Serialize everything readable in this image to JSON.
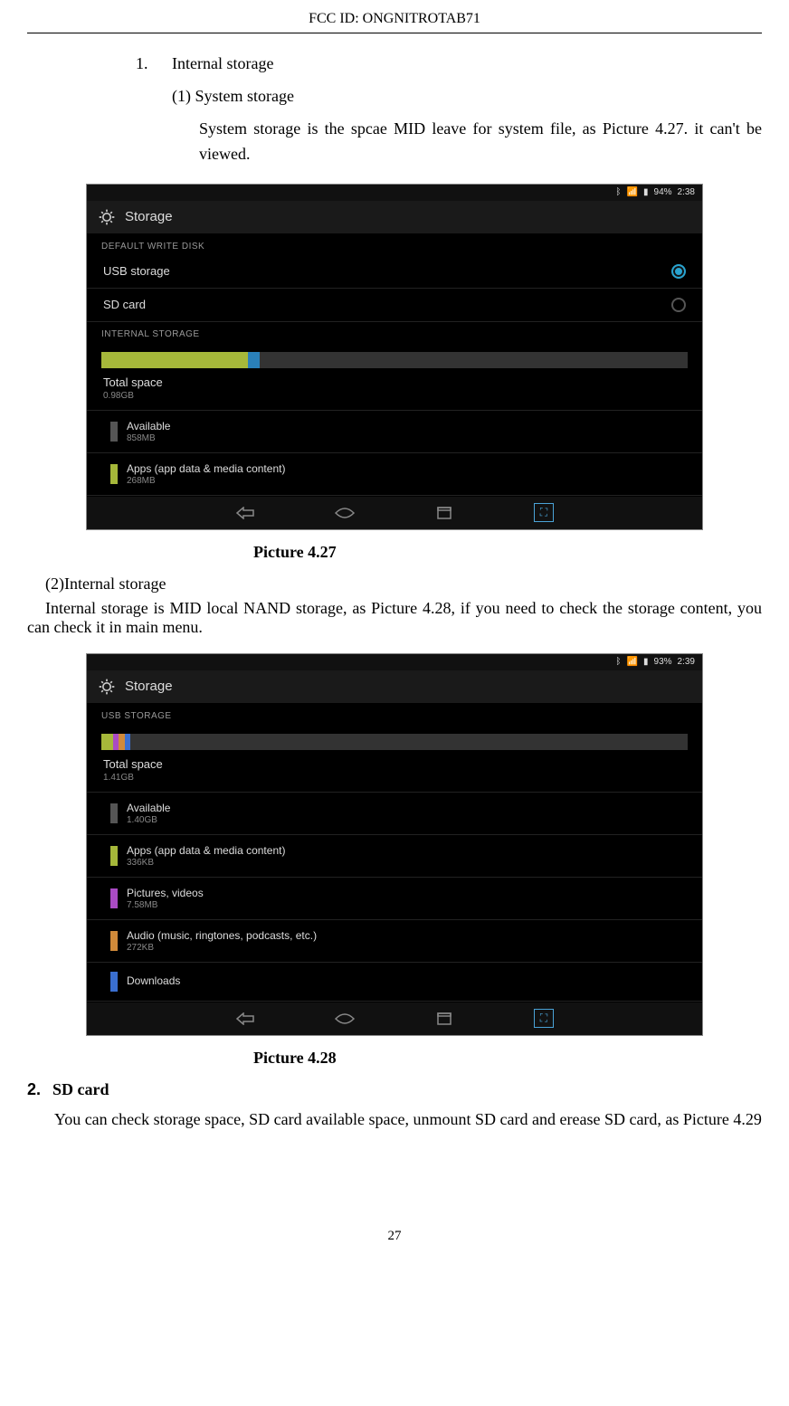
{
  "header": {
    "fcc": "FCC ID:  ONGNITROTAB71"
  },
  "text": {
    "item1_num": "1.",
    "item1_label": "Internal storage",
    "sub1_label": "(1) System storage",
    "sub1_para": "System  storage  is  the  spcae  MID  leave  for  system  file,  as Picture 4.27. it can't be viewed.",
    "caption1": "Picture 4.27",
    "sub2_label": "(2)Internal storage",
    "sub2_para": "Internal storage is MID local NAND storage, as Picture 4.28, if you need to check the storage content, you can check it in main menu.",
    "caption2": "Picture 4.28",
    "item2_num": "2.",
    "item2_label": "SD card",
    "item2_para": "You can check storage space, SD card available space, unmount SD card and erease SD card, as Picture 4.29",
    "page_number": "27"
  },
  "screenshot1": {
    "status": {
      "battery": "94%",
      "time": "2:38"
    },
    "title": "Storage",
    "section_default": "DEFAULT WRITE DISK",
    "opt_usb": "USB storage",
    "opt_sd": "SD card",
    "section_internal": "INTERNAL STORAGE",
    "bar": [
      {
        "color": "#a6b83a",
        "pct": 25
      },
      {
        "color": "#2a80b9",
        "pct": 2
      },
      {
        "color": "#333333",
        "pct": 73
      }
    ],
    "total": {
      "title": "Total space",
      "sub": "0.98GB"
    },
    "rows": [
      {
        "color": "#555555",
        "title": "Available",
        "sub": "858MB"
      },
      {
        "color": "#a6b83a",
        "title": "Apps (app data & media content)",
        "sub": "268MB"
      }
    ]
  },
  "screenshot2": {
    "status": {
      "battery": "93%",
      "time": "2:39"
    },
    "title": "Storage",
    "section_usb": "USB STORAGE",
    "bar": [
      {
        "color": "#a6b83a",
        "pct": 2
      },
      {
        "color": "#aa4bc4",
        "pct": 1
      },
      {
        "color": "#d08a3a",
        "pct": 1
      },
      {
        "color": "#3a6fd0",
        "pct": 1
      },
      {
        "color": "#333333",
        "pct": 95
      }
    ],
    "total": {
      "title": "Total space",
      "sub": "1.41GB"
    },
    "rows": [
      {
        "color": "#555555",
        "title": "Available",
        "sub": "1.40GB"
      },
      {
        "color": "#a6b83a",
        "title": "Apps (app data & media content)",
        "sub": "336KB"
      },
      {
        "color": "#aa4bc4",
        "title": "Pictures, videos",
        "sub": "7.58MB"
      },
      {
        "color": "#d08a3a",
        "title": "Audio (music, ringtones, podcasts, etc.)",
        "sub": "272KB"
      },
      {
        "color": "#3a6fd0",
        "title": "Downloads",
        "sub": ""
      }
    ]
  }
}
